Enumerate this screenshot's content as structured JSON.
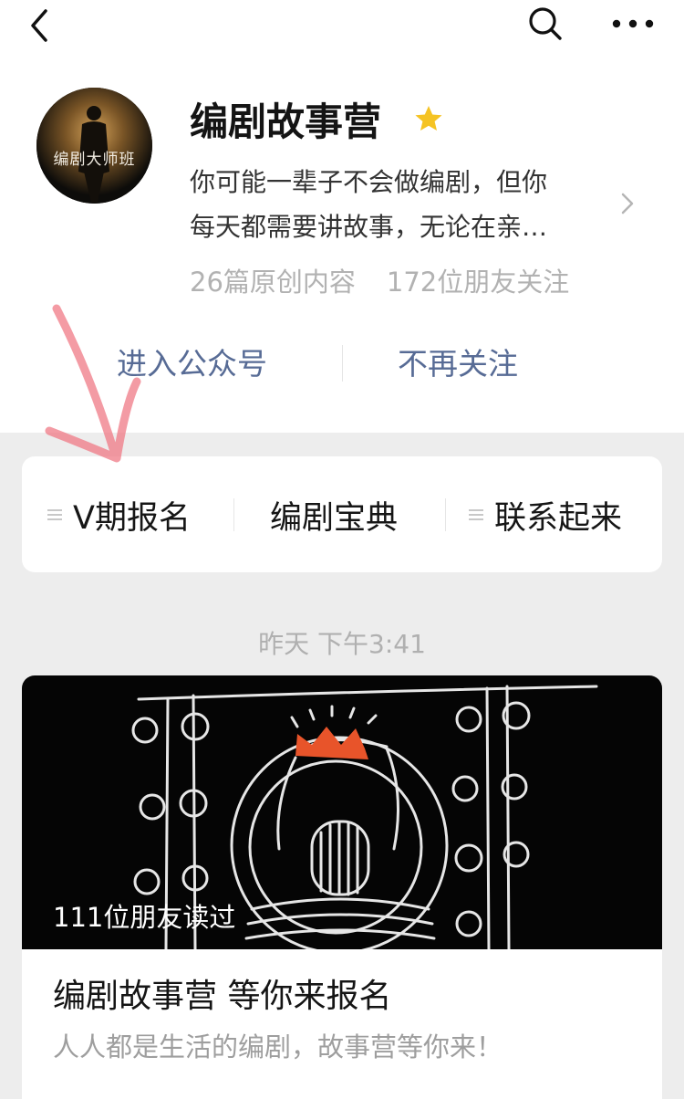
{
  "nav": {
    "back_icon": "chevron-left-icon",
    "search_icon": "search-icon",
    "more_icon": "more-horizontal-icon"
  },
  "account": {
    "avatar_text": "编剧大师班",
    "name": "编剧故事营",
    "star_icon": "star-icon",
    "star_color": "#f5c323",
    "description_lines": [
      "你可能一辈子不会做编剧，但你",
      "每天都需要讲故事，无论在亲…"
    ],
    "original_count": "26篇原创内容",
    "followers": "172位朋友关注"
  },
  "actions": {
    "enter": "进入公众号",
    "unfollow": "不再关注",
    "link_color": "#576b95"
  },
  "menu": {
    "items": [
      {
        "label": "V期报名",
        "icon": "menu-lines-icon"
      },
      {
        "label": "编剧宝典"
      },
      {
        "label": "联系起来",
        "icon": "menu-lines-icon"
      }
    ]
  },
  "timestamp": "昨天 下午3:41",
  "article": {
    "reads": "111位朋友读过",
    "title": "编剧故事营 等你来报名",
    "subtitle": "人人都是生活的编剧，故事营等你来！",
    "crown_color": "#e8542a"
  },
  "annotation_color": "#f07a86"
}
